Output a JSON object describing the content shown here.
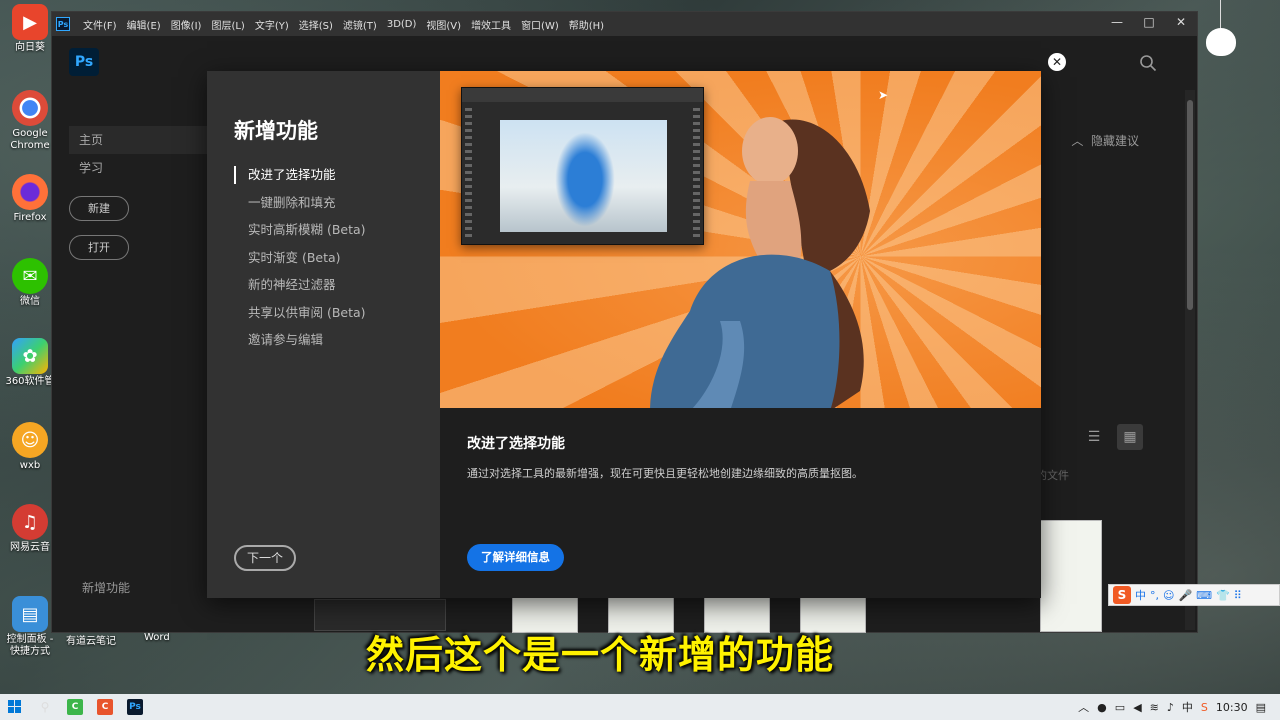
{
  "desktop": {
    "icons": [
      {
        "label": "向日葵",
        "color": "#e8452c",
        "glyph": "▶"
      },
      {
        "label": "Google Chrome",
        "color": "#dd4b39",
        "glyph": "◉"
      },
      {
        "label": "Firefox",
        "color": "#ff7139",
        "glyph": "◎"
      },
      {
        "label": "微信",
        "color": "#2dc100",
        "glyph": "✉"
      },
      {
        "label": "360软件管",
        "color": "#33a0ff",
        "glyph": "✿"
      },
      {
        "label": "wxb",
        "color": "#f6a623",
        "glyph": "☺"
      },
      {
        "label": "网易云音",
        "color": "#d43c33",
        "glyph": "♫"
      },
      {
        "label": "控制面板 - 快捷方式",
        "color": "#3a8fd8",
        "glyph": "▤"
      }
    ],
    "bottom_labels": [
      "有道云笔记",
      "Word"
    ]
  },
  "photoshop": {
    "menu": [
      "文件(F)",
      "编辑(E)",
      "图像(I)",
      "图层(L)",
      "文字(Y)",
      "选择(S)",
      "滤镜(T)",
      "3D(D)",
      "视图(V)",
      "增效工具",
      "窗口(W)",
      "帮助(H)"
    ],
    "logo": "Ps",
    "nav": [
      "主页",
      "学习"
    ],
    "new_button": "新建",
    "open_button": "打开",
    "hide_suggestions": "隐藏建议",
    "files_label": "的文件",
    "bottom_label": "新增功能"
  },
  "dialog": {
    "title": "新增功能",
    "features": [
      "改进了选择功能",
      "一键删除和填充",
      "实时高斯模糊 (Beta)",
      "实时渐变 (Beta)",
      "新的神经过滤器",
      "共享以供审阅 (Beta)",
      "邀请参与编辑"
    ],
    "active_index": 0,
    "next_button": "下一个",
    "heading": "改进了选择功能",
    "description": "通过对选择工具的最新增强，现在可更快且更轻松地创建边缘细致的高质量抠图。",
    "learn_more_button": "了解详细信息"
  },
  "ime": {
    "items": [
      "中",
      "°,",
      "☺",
      "🎤",
      "⌨",
      "👕",
      "⠿"
    ]
  },
  "subtitle": "然后这个是一个新增的功能",
  "taskbar": {
    "clock": "10:30",
    "ime_lang": "中",
    "colors": {
      "green_app": "#3cb54a",
      "red_app": "#e8542c",
      "ps_app": "#0a1a2e"
    }
  }
}
